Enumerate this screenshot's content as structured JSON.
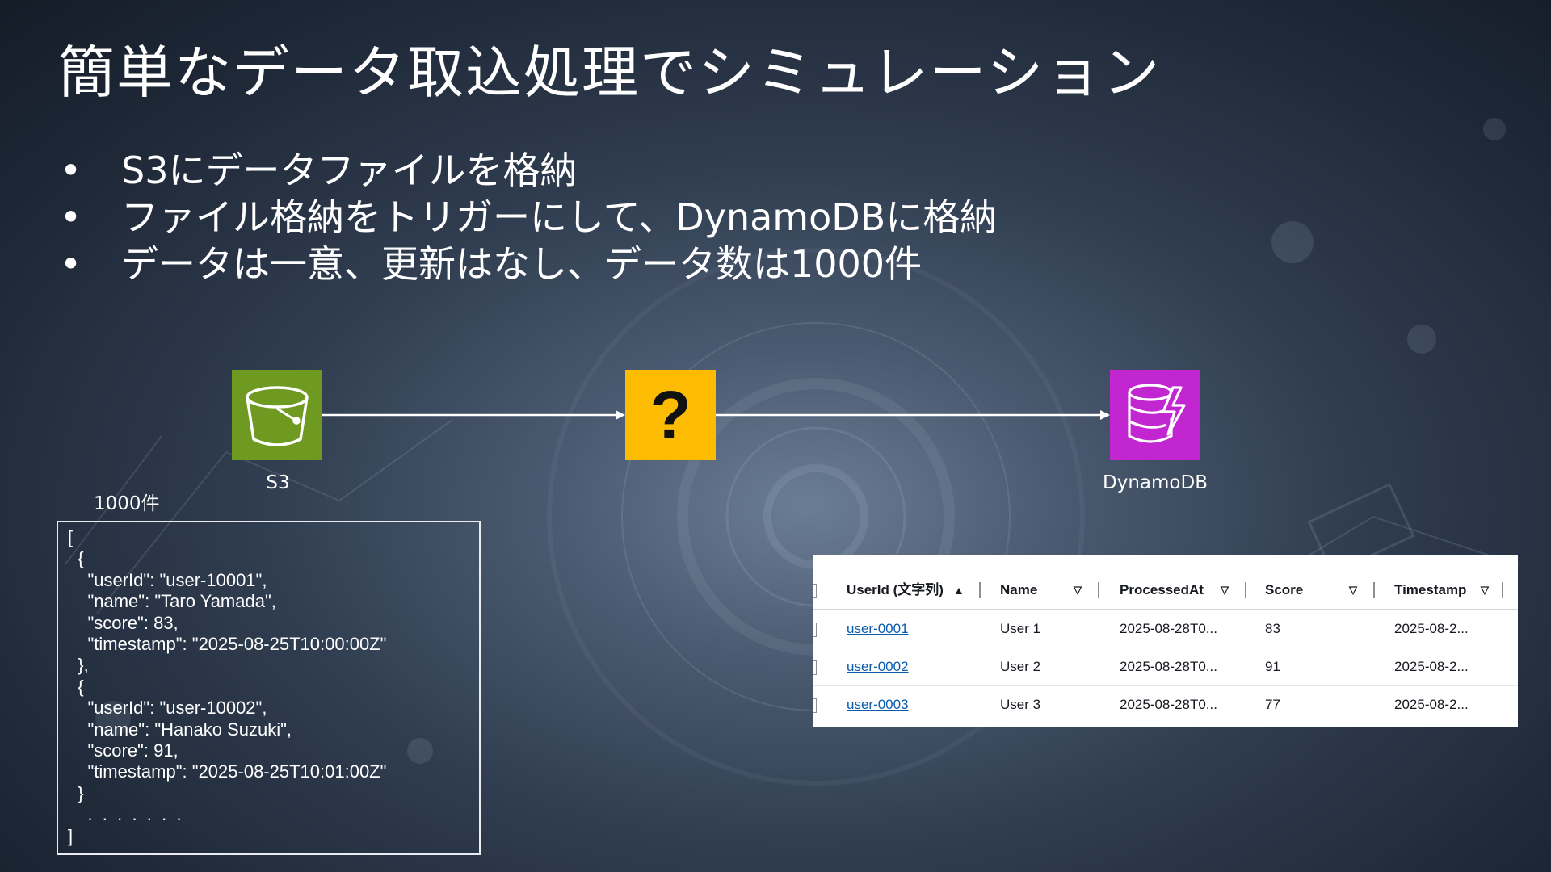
{
  "slide": {
    "title": "簡単なデータ取込処理でシミュレーション",
    "bullets": [
      "S3にデータファイルを格納",
      "ファイル格納をトリガーにして、DynamoDBに格納",
      "データは一意、更新はなし、データ数は1000件"
    ]
  },
  "diagram": {
    "nodes": [
      {
        "label": "S3",
        "icon": "s3-bucket-icon",
        "color": "#6e9a22"
      },
      {
        "label": "?",
        "icon": "question-mark",
        "color": "#fdbc02"
      },
      {
        "label": "DynamoDB",
        "icon": "dynamodb-icon",
        "color": "#c126d0"
      }
    ],
    "count_label": "1000件"
  },
  "json_sample": "[\n  {\n    \"userId\": \"user-10001\",\n    \"name\": \"Taro Yamada\",\n    \"score\": 83,\n    \"timestamp\": \"2025-08-25T10:00:00Z\"\n  },\n  {\n    \"userId\": \"user-10002\",\n    \"name\": \"Hanako Suzuki\",\n    \"score\": 91,\n    \"timestamp\": \"2025-08-25T10:01:00Z\"\n  }\n    .  .  .  .  .  .  .\n]",
  "table": {
    "headers": [
      "UserId (文字列)",
      "Name",
      "ProcessedAt",
      "Score",
      "Timestamp"
    ],
    "rows": [
      {
        "userId": "user-0001",
        "name": "User 1",
        "processedAt": "2025-08-28T0...",
        "score": "83",
        "timestamp": "2025-08-2..."
      },
      {
        "userId": "user-0002",
        "name": "User 2",
        "processedAt": "2025-08-28T0...",
        "score": "91",
        "timestamp": "2025-08-2..."
      },
      {
        "userId": "user-0003",
        "name": "User 3",
        "processedAt": "2025-08-28T0...",
        "score": "77",
        "timestamp": "2025-08-2..."
      }
    ]
  }
}
